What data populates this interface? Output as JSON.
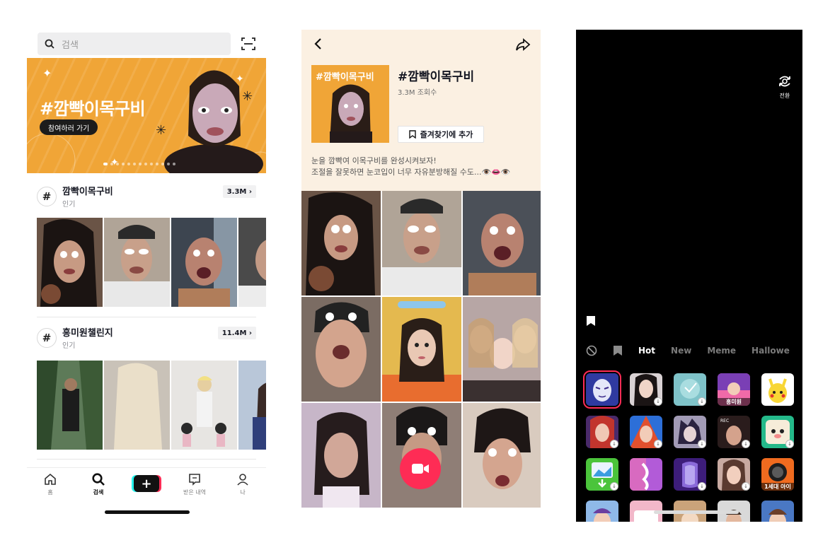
{
  "search": {
    "placeholder": "검색",
    "banner": {
      "title": "#깜빡이목구비",
      "cta": "참여하러 가기"
    },
    "hashtags": [
      {
        "name": "깜빡이목구비",
        "sub": "인기",
        "count": "3.3M"
      },
      {
        "name": "흥미원챌린지",
        "sub": "인기",
        "count": "11.4M"
      }
    ],
    "tabs": [
      {
        "label": "홈",
        "icon": "home-icon"
      },
      {
        "label": "검색",
        "icon": "search-icon"
      },
      {
        "label": "",
        "icon": "create-plus-icon"
      },
      {
        "label": "받은 내역",
        "icon": "inbox-icon"
      },
      {
        "label": "나",
        "icon": "profile-icon"
      }
    ],
    "active_tab": "검색"
  },
  "hashtag_page": {
    "cover_text": "#깜빡이목구비",
    "title": "#깜빡이목구비",
    "views": "3.3M 조회수",
    "favorite_label": "즐겨찾기에 추가",
    "description": [
      "눈을 깜빡여 이목구비를 완성시켜보자!",
      "조절을 잘못하면 눈코입이 너무 자유분방해질 수도...👁️👄👁️"
    ]
  },
  "camera": {
    "flip_label": "전환",
    "filter_tabs": [
      "Hot",
      "New",
      "Meme",
      "Hallowe"
    ],
    "active_filter": "Hot",
    "effect_captions": {
      "fx4": "흥미원",
      "fx20": "1세대 아이"
    }
  },
  "colors": {
    "brand_red": "#fe2c55",
    "brand_cyan": "#25f4ee",
    "banner_orange": "#f0a537"
  }
}
